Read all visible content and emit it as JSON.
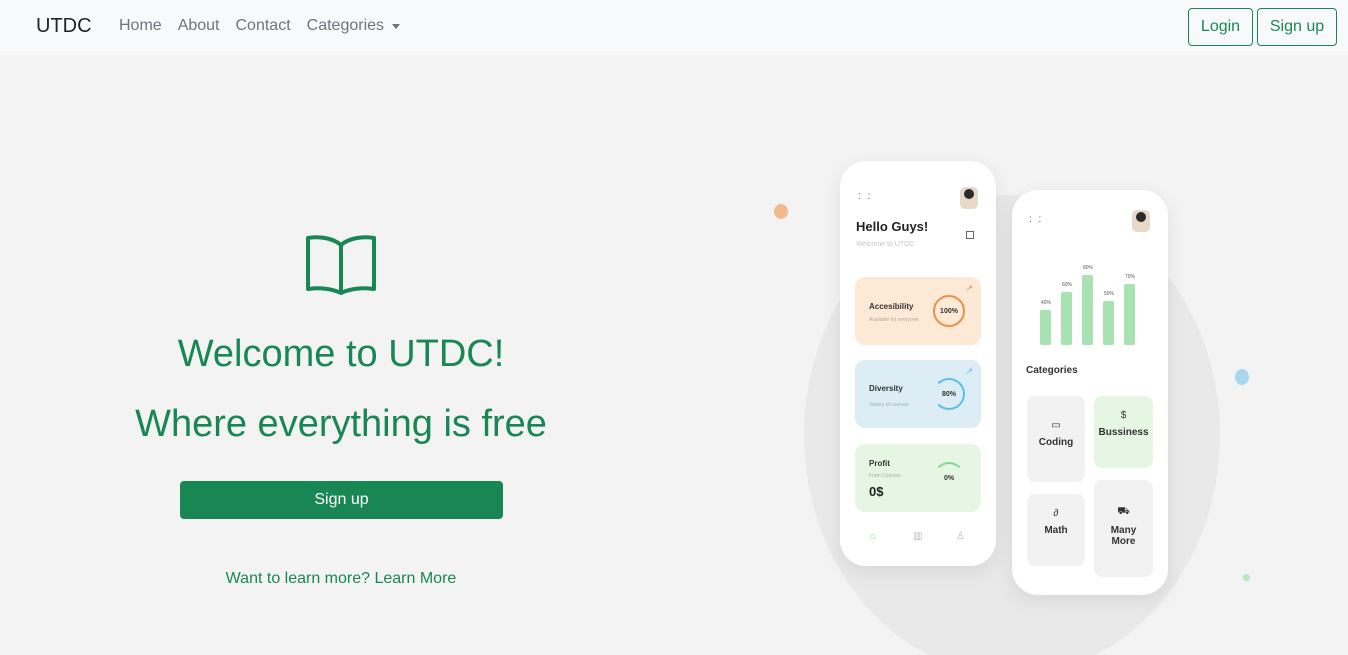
{
  "nav": {
    "brand": "UTDC",
    "links": [
      "Home",
      "About",
      "Contact"
    ],
    "dropdown_label": "Categories",
    "login_label": "Login",
    "signup_label": "Sign up"
  },
  "hero": {
    "icon": "open-book-icon",
    "title_line1": "Welcome to UTDC!",
    "title_line2": "Where everything is free",
    "cta_label": "Sign up",
    "learn_prefix": "Want to learn more?",
    "learn_link": "Learn More"
  },
  "colors": {
    "accent": "#198754",
    "navbar_bg": "#f8f9fa",
    "page_bg": "#f3f3f3"
  },
  "illustration": {
    "phone1": {
      "greeting": "Hello Guys!",
      "subtitle": "Welcome to UTDC",
      "cards": [
        {
          "label": "Accesibility",
          "sub": "Available for everyone",
          "value": "100%"
        },
        {
          "label": "Diversity",
          "sub": "Variety of courses",
          "value": "80%"
        },
        {
          "label": "Profit",
          "sub": "From Courses",
          "value": "0%",
          "amount": "0$"
        }
      ]
    },
    "phone2": {
      "bars": [
        {
          "label": "40%",
          "value": 40
        },
        {
          "label": "60%",
          "value": 60
        },
        {
          "label": "80%",
          "value": 80
        },
        {
          "label": "50%",
          "value": 50
        },
        {
          "label": "70%",
          "value": 70
        }
      ],
      "categories_title": "Categories",
      "categories": [
        "Coding",
        "Bussiness",
        "Math",
        "Many More"
      ]
    }
  }
}
